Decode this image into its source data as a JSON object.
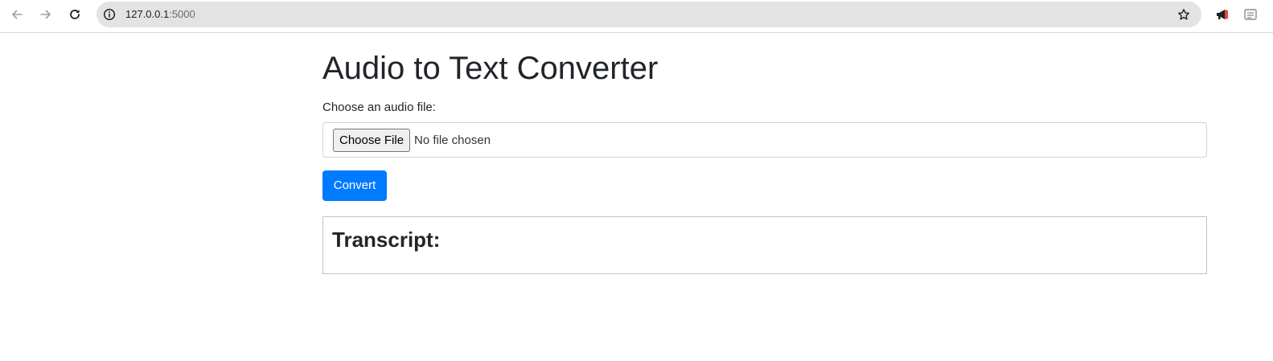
{
  "browser": {
    "url_host": "127.0.0.1",
    "url_port": ":5000",
    "icons": {
      "back": "arrow-left-icon",
      "forward": "arrow-right-icon",
      "reload": "reload-icon",
      "site_info": "info-icon",
      "bookmark": "star-icon",
      "extension_1": "megaphone-icon",
      "extension_2": "reader-icon"
    },
    "accent_extension_color": "#e8453c"
  },
  "page": {
    "title": "Audio to Text Converter",
    "file_label": "Choose an audio file:",
    "choose_file_label": "Choose File",
    "no_file_text": "No file chosen",
    "convert_label": "Convert",
    "transcript_heading": "Transcript:",
    "primary_color": "#007bff"
  }
}
